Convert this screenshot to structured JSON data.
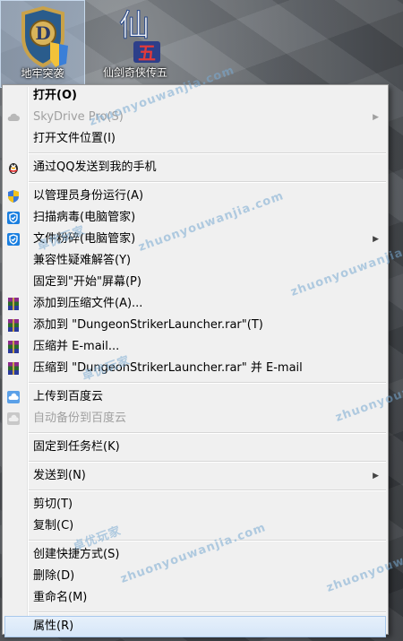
{
  "desktop": {
    "icons": [
      {
        "label": "地牢突袭",
        "icon": "dungeon-striker-shield-icon"
      },
      {
        "label": "仙剑奇侠传五",
        "icon": "xianjian-game-icon"
      }
    ],
    "watermark": "zhuonyouwanjia.com",
    "watermark_cn": "卓优玩家"
  },
  "menu": {
    "items": [
      {
        "label": "打开(O)",
        "bold": true
      },
      {
        "label": "SkyDrive Pro(S)",
        "disabled": true,
        "submenu": true,
        "icon": "cloud-icon"
      },
      {
        "label": "打开文件位置(I)"
      },
      {
        "sep": true
      },
      {
        "label": "通过QQ发送到我的手机",
        "icon": "qq-penguin-icon"
      },
      {
        "sep": true
      },
      {
        "label": "以管理员身份运行(A)",
        "icon": "uac-shield-icon"
      },
      {
        "label": "扫描病毒(电脑管家)",
        "icon": "tencent-guard-icon"
      },
      {
        "label": "文件粉碎(电脑管家)",
        "icon": "tencent-guard-icon",
        "submenu": true
      },
      {
        "label": "兼容性疑难解答(Y)"
      },
      {
        "label": "固定到\"开始\"屏幕(P)"
      },
      {
        "label": "添加到压缩文件(A)...",
        "icon": "winrar-icon"
      },
      {
        "label": "添加到 \"DungeonStrikerLauncher.rar\"(T)",
        "icon": "winrar-icon"
      },
      {
        "label": "压缩并 E-mail...",
        "icon": "winrar-icon"
      },
      {
        "label": "压缩到 \"DungeonStrikerLauncher.rar\" 并 E-mail",
        "icon": "winrar-icon"
      },
      {
        "sep": true
      },
      {
        "label": "上传到百度云",
        "icon": "baidu-cloud-icon"
      },
      {
        "label": "自动备份到百度云",
        "disabled": true,
        "icon": "baidu-backup-icon"
      },
      {
        "sep": true
      },
      {
        "label": "固定到任务栏(K)"
      },
      {
        "sep": true
      },
      {
        "label": "发送到(N)",
        "submenu": true
      },
      {
        "sep": true
      },
      {
        "label": "剪切(T)"
      },
      {
        "label": "复制(C)"
      },
      {
        "sep": true
      },
      {
        "label": "创建快捷方式(S)"
      },
      {
        "label": "删除(D)"
      },
      {
        "label": "重命名(M)"
      },
      {
        "sep": true
      },
      {
        "label": "属性(R)",
        "highlighted": true
      }
    ]
  }
}
